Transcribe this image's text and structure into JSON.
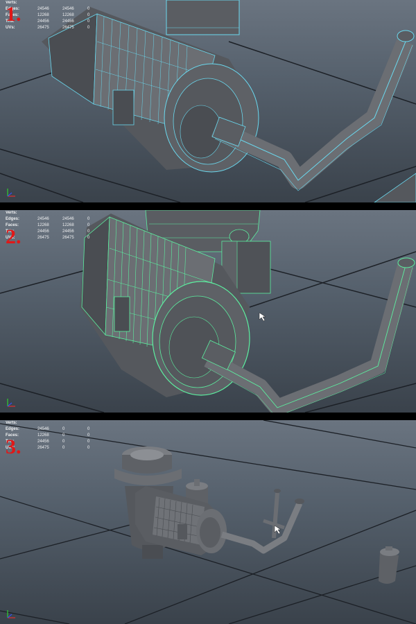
{
  "panels": [
    {
      "step": "1.",
      "hud": [
        {
          "label": "Verts:",
          "v1": "",
          "v2": "",
          "v3": ""
        },
        {
          "label": "Edges:",
          "v1": "24546",
          "v2": "24546",
          "v3": "0"
        },
        {
          "label": "Faces:",
          "v1": "12268",
          "v2": "12268",
          "v3": "0"
        },
        {
          "label": "Tris:",
          "v1": "24456",
          "v2": "24456",
          "v3": "0"
        },
        {
          "label": "UVs:",
          "v1": "26475",
          "v2": "26475",
          "v3": "0"
        }
      ]
    },
    {
      "step": "2.",
      "hud": [
        {
          "label": "Verts:",
          "v1": "",
          "v2": "",
          "v3": ""
        },
        {
          "label": "Edges:",
          "v1": "24546",
          "v2": "24546",
          "v3": "0"
        },
        {
          "label": "Faces:",
          "v1": "12268",
          "v2": "12268",
          "v3": "0"
        },
        {
          "label": "Tris:",
          "v1": "24456",
          "v2": "24456",
          "v3": "0"
        },
        {
          "label": "UVs:",
          "v1": "26475",
          "v2": "26475",
          "v3": "0"
        }
      ]
    },
    {
      "step": "3.",
      "hud": [
        {
          "label": "Verts:",
          "v1": "",
          "v2": "",
          "v3": ""
        },
        {
          "label": "Edges:",
          "v1": "24546",
          "v2": "0",
          "v3": "0"
        },
        {
          "label": "Faces:",
          "v1": "12268",
          "v2": "0",
          "v3": "0"
        },
        {
          "label": "Tris:",
          "v1": "24456",
          "v2": "0",
          "v3": "0"
        },
        {
          "label": "UVs:",
          "v1": "26475",
          "v2": "0",
          "v3": "0"
        }
      ]
    }
  ],
  "colors": {
    "step_number": "#e01818",
    "wire_panel1": "#6ad8ee",
    "wire_panel2": "#5cf0a0",
    "mesh_dark": "#4a4d52",
    "mesh_mid": "#6b6e73",
    "mesh_light": "#8c8f94",
    "grid": "#1c2026",
    "viewport_top": "#6a7480",
    "viewport_bottom": "#3a424b"
  },
  "icons": {
    "axis_gizmo": "xyz-axis-icon",
    "cursor": "mouse-cursor-icon"
  }
}
